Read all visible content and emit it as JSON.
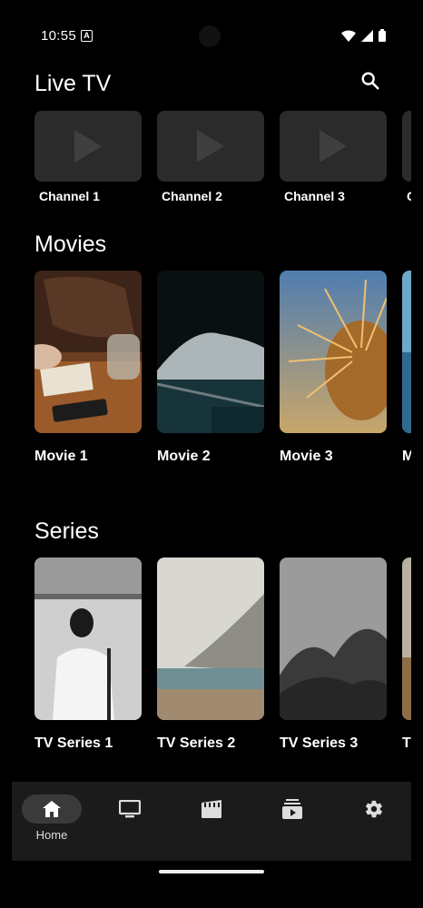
{
  "status": {
    "time": "10:55",
    "notif_letter": "A"
  },
  "live": {
    "title": "Live TV",
    "channels": [
      {
        "label": "Channel 1"
      },
      {
        "label": "Channel 2"
      },
      {
        "label": "Channel 3"
      },
      {
        "label": "C"
      }
    ]
  },
  "movies": {
    "title": "Movies",
    "items": [
      {
        "label": "Movie 1"
      },
      {
        "label": "Movie 2"
      },
      {
        "label": "Movie 3"
      },
      {
        "label": "M"
      }
    ]
  },
  "series": {
    "title": "Series",
    "items": [
      {
        "label": "TV Series 1"
      },
      {
        "label": "TV Series 2"
      },
      {
        "label": "TV Series 3"
      },
      {
        "label": "T"
      }
    ]
  },
  "nav": {
    "items": [
      {
        "label": "Home",
        "icon": "home-icon",
        "active": true
      },
      {
        "label": "",
        "icon": "tv-icon"
      },
      {
        "label": "",
        "icon": "movie-icon"
      },
      {
        "label": "",
        "icon": "video-library-icon"
      },
      {
        "label": "",
        "icon": "settings-icon"
      }
    ]
  },
  "colors": {
    "background": "#000000",
    "card_placeholder": "#2b2b2b",
    "nav_background": "#1b1b1b"
  }
}
